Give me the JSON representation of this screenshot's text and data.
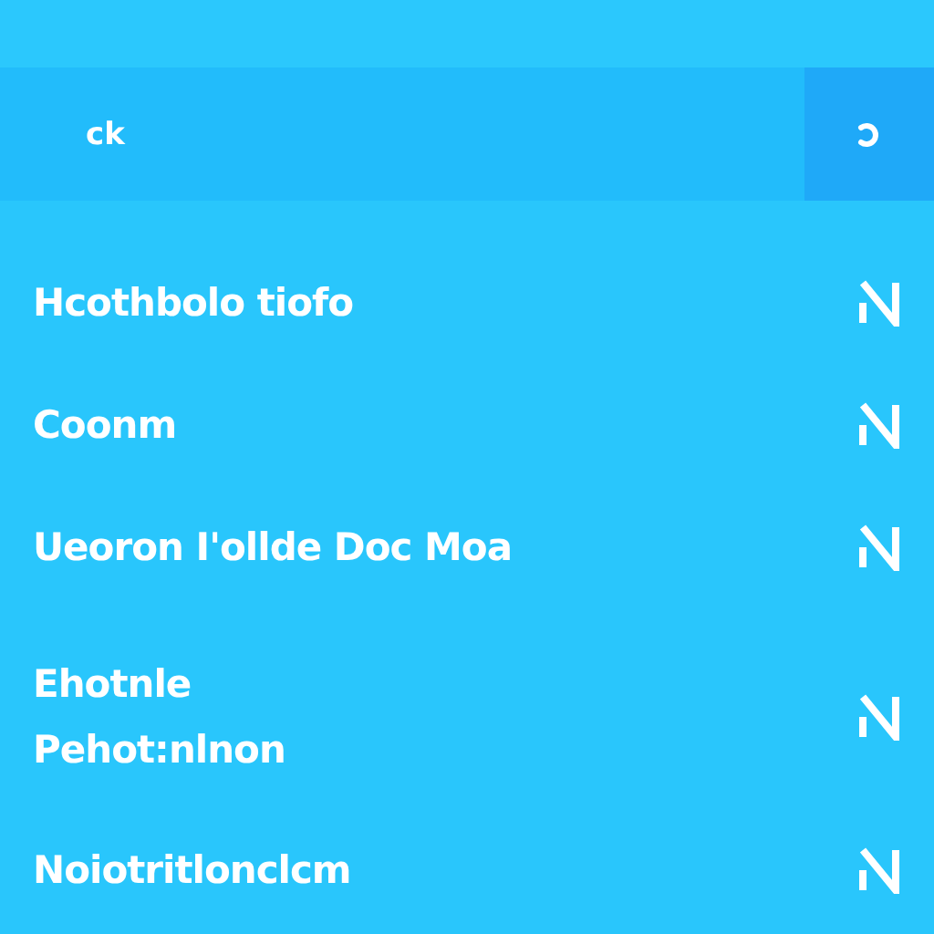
{
  "header": {
    "title": "ck"
  },
  "items": [
    {
      "label": "Hcothbolo tiofo"
    },
    {
      "label": "Coonm"
    },
    {
      "label": "Ueoron I'ollde Doc Moa"
    },
    {
      "label": "Ehotnle",
      "sublabel": "Pehot:nlnon"
    },
    {
      "label": "Noiotritlonclcm"
    }
  ]
}
